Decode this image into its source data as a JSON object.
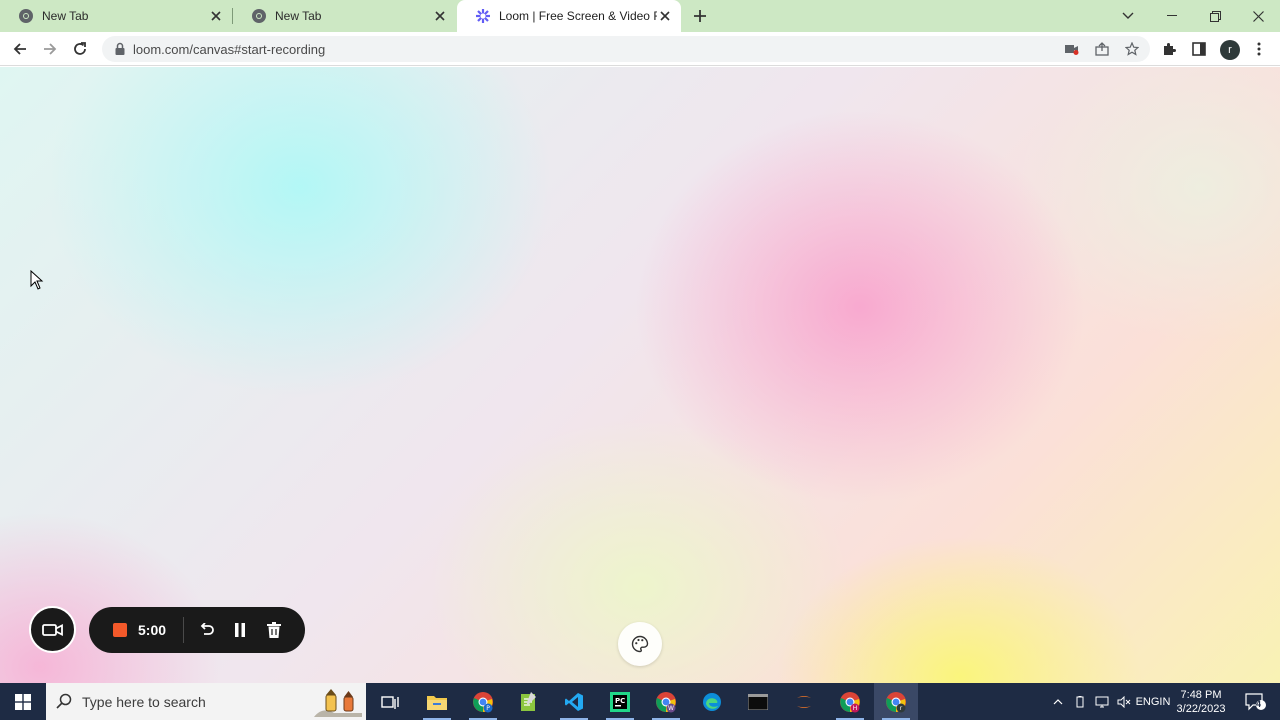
{
  "browser": {
    "tabs": [
      {
        "title": "New Tab",
        "favicon": "chrome-icon",
        "active": false
      },
      {
        "title": "New Tab",
        "favicon": "chrome-icon",
        "active": false
      },
      {
        "title": "Loom | Free Screen & Video Recording",
        "favicon": "loom-icon",
        "active": true
      }
    ],
    "address_bar": {
      "url": "loom.com/canvas#start-recording"
    },
    "profile_initial": "r",
    "colors": {
      "tabstrip": "#cde8c4",
      "omnibox": "#f1f3f4"
    }
  },
  "recorder": {
    "timer": "5:00",
    "colors": {
      "stop": "#f3592a",
      "bar": "#1a1a1a"
    }
  },
  "taskbar": {
    "search_placeholder": "Type here to search",
    "apps": [
      "task-view-icon",
      "file-explorer-icon",
      "chrome-icon",
      "notepad-icon",
      "vscode-icon",
      "pycharm-icon",
      "chrome-icon",
      "edge-icon",
      "terminal-icon",
      "jupyter-icon",
      "chrome-icon",
      "chrome-icon"
    ],
    "language": "ENG",
    "region": "IN",
    "time": "7:48 PM",
    "date": "3/22/2023",
    "notification_count": "4"
  }
}
